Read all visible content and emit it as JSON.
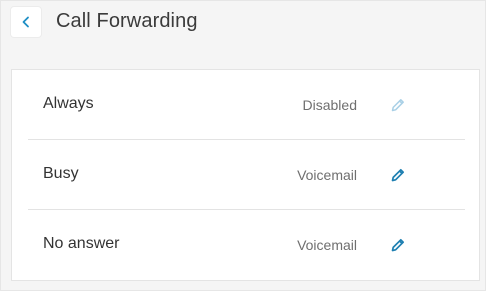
{
  "header": {
    "title": "Call Forwarding",
    "back_icon": "chevron-left-icon"
  },
  "colors": {
    "accent": "#1e7fb1",
    "accent_disabled": "#a9d0e6",
    "back_chevron": "#1e8ec4"
  },
  "forwarding": {
    "rows": [
      {
        "label": "Always",
        "value": "Disabled",
        "edit_icon": "pencil-icon",
        "edit_enabled": false
      },
      {
        "label": "Busy",
        "value": "Voicemail",
        "edit_icon": "pencil-icon",
        "edit_enabled": true
      },
      {
        "label": "No answer",
        "value": "Voicemail",
        "edit_icon": "pencil-icon",
        "edit_enabled": true
      }
    ]
  }
}
